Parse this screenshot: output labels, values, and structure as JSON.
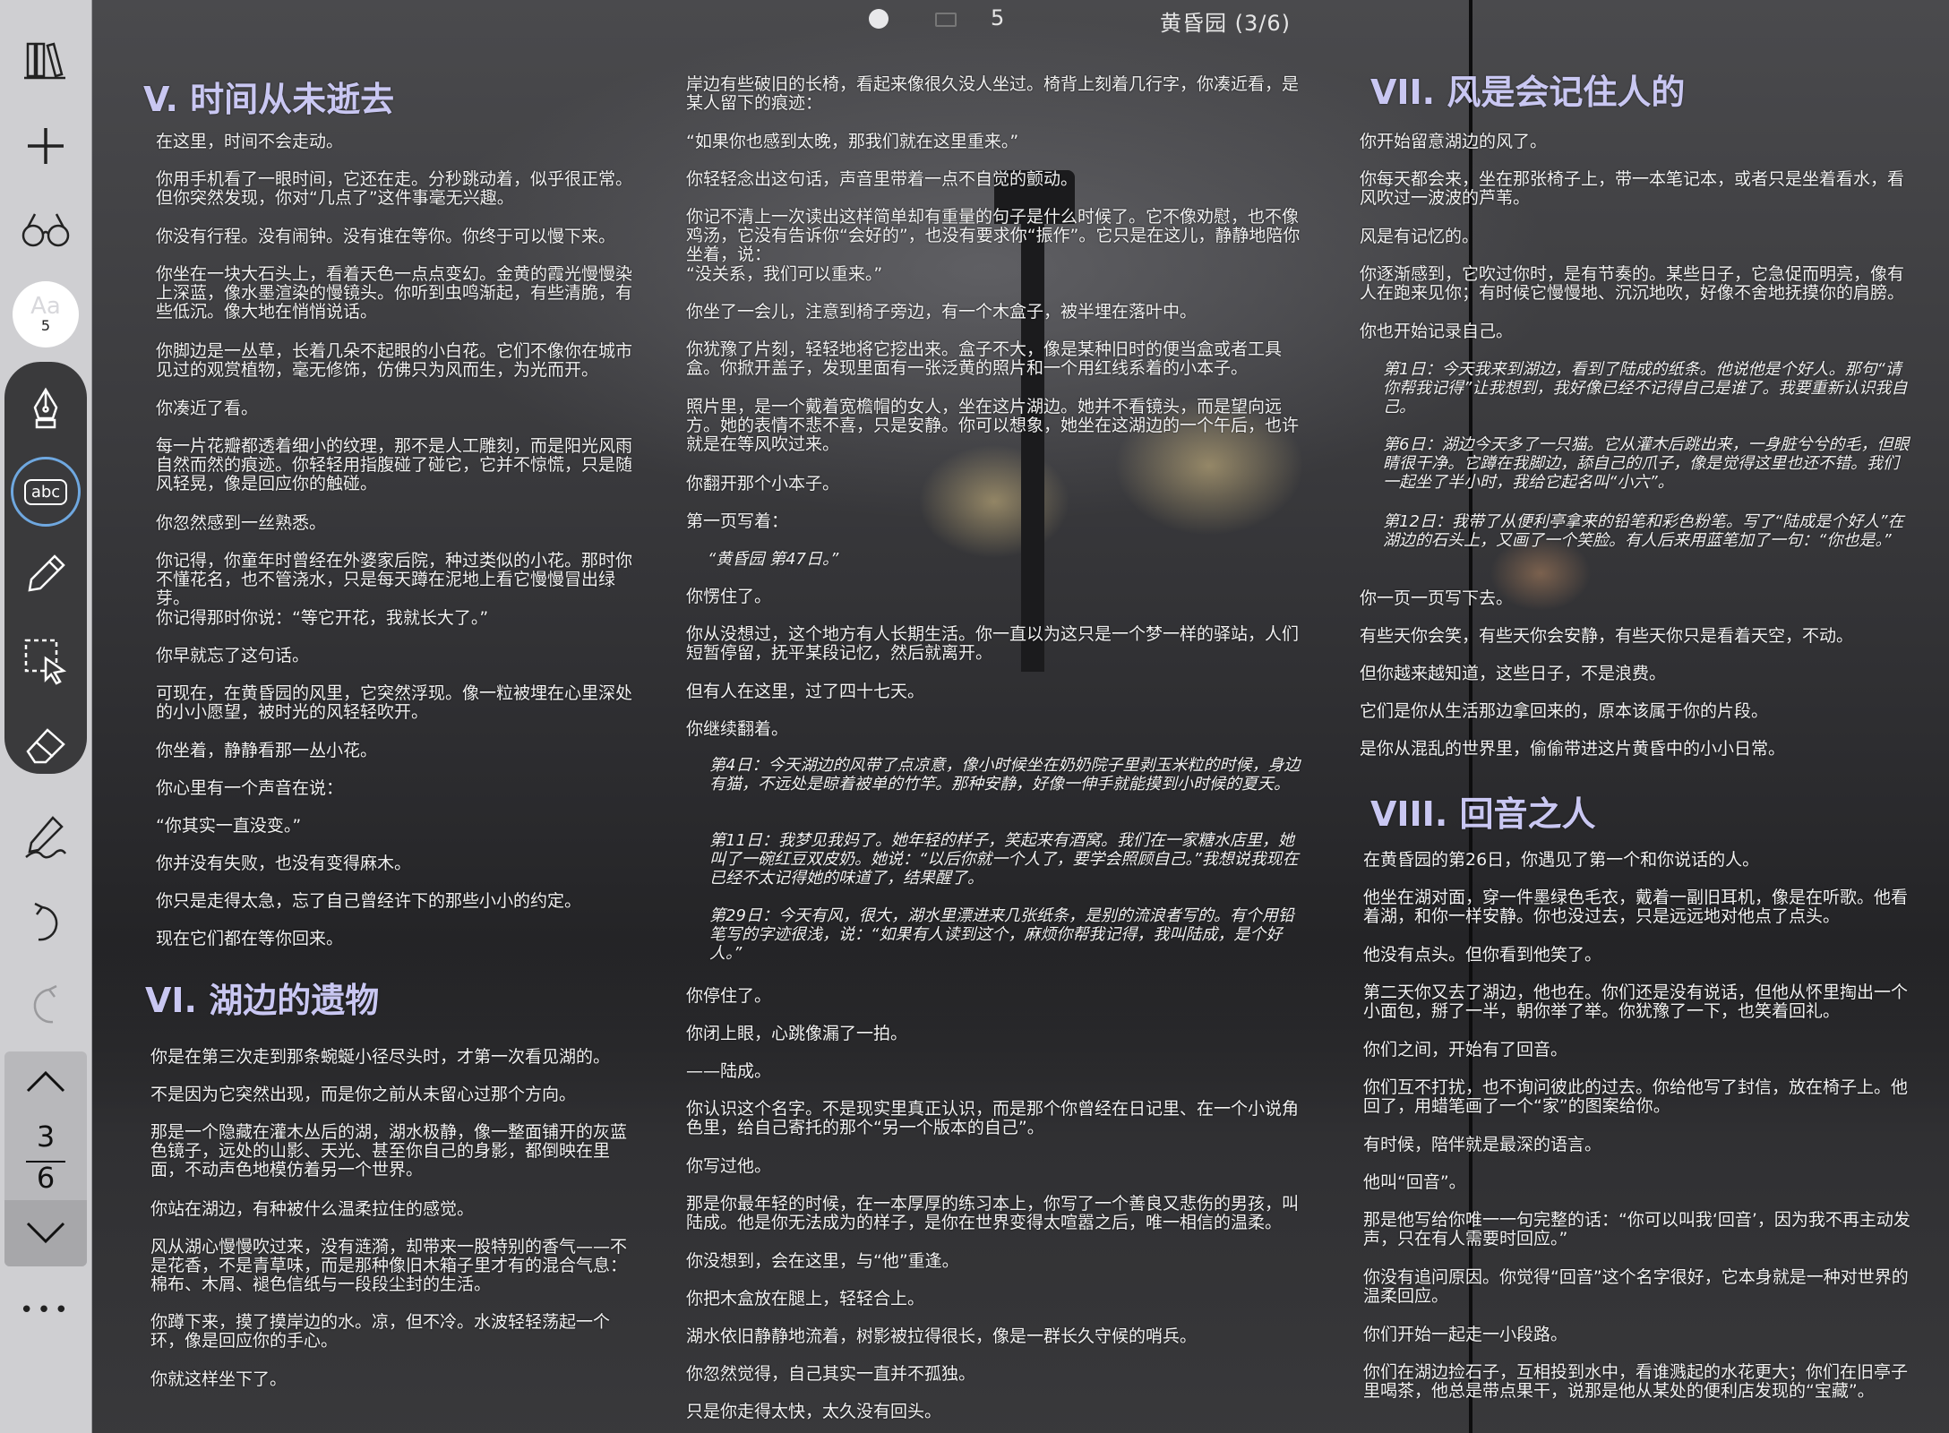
{
  "topbar": {
    "page": "5",
    "title": "黄昏园 (3/6)"
  },
  "sidebar": {
    "font_size": "5",
    "font_label": "Aa",
    "abc_label": "abc",
    "current_page": "3",
    "total_pages": "6",
    "more": "•••"
  },
  "col1": {
    "ch5_title": "V. 时间从未逝去",
    "ch5_paras": [
      "在这里，时间不会走动。",
      "你用手机看了一眼时间，它还在走。分秒跳动着，似乎很正常。但你突然发现，你对“几点了”这件事毫无兴趣。",
      "你没有行程。没有闹钟。没有谁在等你。你终于可以慢下来。",
      "你坐在一块大石头上，看着天色一点点变幻。金黄的霞光慢慢染上深蓝，像水墨渲染的慢镜头。你听到虫鸣渐起，有些清脆，有些低沉。像大地在悄悄说话。",
      "你脚边是一丛草，长着几朵不起眼的小白花。它们不像你在城市见过的观赏植物，毫无修饰，仿佛只为风而生，为光而开。",
      "你凑近了看。",
      "每一片花瓣都透着细小的纹理，那不是人工雕刻，而是阳光风雨自然而然的痕迹。你轻轻用指腹碰了碰它，它并不惊慌，只是随风轻晃，像是回应你的触碰。",
      "你忽然感到一丝熟悉。",
      "你记得，你童年时曾经在外婆家后院，种过类似的小花。那时你不懂花名，也不管浇水，只是每天蹲在泥地上看它慢慢冒出绿芽。",
      "你记得那时你说：“等它开花，我就长大了。”",
      "你早就忘了这句话。",
      "可现在，在黄昏园的风里，它突然浮现。像一粒被埋在心里深处的小小愿望，被时光的风轻轻吹开。",
      "你坐着，静静看那一丛小花。",
      "你心里有一个声音在说：",
      "“你其实一直没变。”",
      "你并没有失败，也没有变得麻木。",
      "你只是走得太急，忘了自己曾经许下的那些小小的约定。",
      "现在它们都在等你回来。"
    ],
    "ch6_title": "VI. 湖边的遗物",
    "ch6_paras": [
      "你是在第三次走到那条蜿蜒小径尽头时，才第一次看见湖的。",
      "不是因为它突然出现，而是你之前从未留心过那个方向。",
      "那是一个隐藏在灌木丛后的湖，湖水极静，像一整面铺开的灰蓝色镜子，远处的山影、天光、甚至你自己的身影，都倒映在里面，不动声色地模仿着另一个世界。",
      "你站在湖边，有种被什么温柔拉住的感觉。",
      "风从湖心慢慢吹过来，没有涟漪，却带来一股特别的香气——不是花香，不是青草味，而是那种像旧木箱子里才有的混合气息：棉布、木屑、褪色信纸与一段段尘封的生活。",
      "你蹲下来，摸了摸岸边的水。凉，但不冷。水波轻轻荡起一个环，像是回应你的手心。",
      "你就这样坐下了。"
    ]
  },
  "col2": {
    "paras_a": [
      "岸边有些破旧的长椅，看起来像很久没人坐过。椅背上刻着几行字，你凑近看，是某人留下的痕迹：",
      "“如果你也感到太晚，那我们就在这里重来。”",
      "你轻轻念出这句话，声音里带着一点不自觉的颤动。",
      "你记不清上一次读出这样简单却有重量的句子是什么时候了。它不像劝慰，也不像鸡汤，它没有告诉你“会好的”，也没有要求你“振作”。它只是在这儿，静静地陪你坐着，说：",
      "“没关系，我们可以重来。”",
      "你坐了一会儿，注意到椅子旁边，有一个木盒子，被半埋在落叶中。",
      "你犹豫了片刻，轻轻地将它挖出来。盒子不大，像是某种旧时的便当盒或者工具盒。你掀开盖子，发现里面有一张泛黄的照片和一个用红线系着的小本子。",
      "照片里，是一个戴着宽檐帽的女人，坐在这片湖边。她并不看镜头，而是望向远方。她的表情不悲不喜，只是安静。你可以想象，她坐在这湖边的一个午后，也许就是在等风吹过来。",
      "你翻开那个小本子。",
      "第一页写着："
    ],
    "quote": "“黄昏园 第47日。”",
    "paras_b": [
      "你愣住了。",
      "你从没想过，这个地方有人长期生活。你一直以为这只是一个梦一样的驿站，人们短暂停留，抚平某段记忆，然后就离开。",
      "但有人在这里，过了四十七天。",
      "你继续翻着。"
    ],
    "journal": [
      "第4日：今天湖边的风带了点凉意，像小时候坐在奶奶院子里剥玉米粒的时候，身边有猫，不远处是晾着被单的竹竿。那种安静，好像一伸手就能摸到小时候的夏天。",
      "第11日：我梦见我妈了。她年轻的样子，笑起来有酒窝。我们在一家糖水店里，她叫了一碗红豆双皮奶。她说：“以后你就一个人了，要学会照顾自己。”我想说我现在已经不太记得她的味道了，结果醒了。",
      "第29日：今天有风，很大，湖水里漂进来几张纸条，是别的流浪者写的。有个用铅笔写的字迹很浅，说：“如果有人读到这个，麻烦你帮我记得，我叫陆成，是个好人。”"
    ],
    "paras_c": [
      "你停住了。",
      "你闭上眼，心跳像漏了一拍。",
      "——陆成。",
      "你认识这个名字。不是现实里真正认识，而是那个你曾经在日记里、在一个小说角色里，给自己寄托的那个“另一个版本的自己”。",
      "你写过他。",
      "那是你最年轻的时候，在一本厚厚的练习本上，你写了一个善良又悲伤的男孩，叫陆成。他是你无法成为的样子，是你在世界变得太喧嚣之后，唯一相信的温柔。",
      "你没想到，会在这里，与“他”重逢。",
      "你把木盒放在腿上，轻轻合上。",
      "湖水依旧静静地流着，树影被拉得很长，像是一群长久守候的哨兵。",
      "你忽然觉得，自己其实一直并不孤独。",
      "只是你走得太快，太久没有回头。"
    ]
  },
  "col3": {
    "ch7_title": "VII. 风是会记住人的",
    "ch7_paras_a": [
      "你开始留意湖边的风了。",
      "你每天都会来，坐在那张椅子上，带一本笔记本，或者只是坐着看水，看风吹过一波波的芦苇。",
      "风是有记忆的。",
      "你逐渐感到，它吹过你时，是有节奏的。某些日子，它急促而明亮，像有人在跑来见你；有时候它慢慢地、沉沉地吹，好像不舍地抚摸你的肩膀。",
      "你也开始记录自己。"
    ],
    "journal": [
      "第1日：今天我来到湖边，看到了陆成的纸条。他说他是个好人。那句“请你帮我记得”让我想到，我好像已经不记得自己是谁了。我要重新认识我自己。",
      "第6日：湖边今天多了一只猫。它从灌木后跳出来，一身脏兮兮的毛，但眼睛很干净。它蹲在我脚边，舔自己的爪子，像是觉得这里也还不错。我们一起坐了半小时，我给它起名叫“小六”。",
      "第12日：我带了从便利亭拿来的铅笔和彩色粉笔。写了“陆成是个好人”在湖边的石头上，又画了一个笑脸。有人后来用蓝笔加了一句：“你也是。”"
    ],
    "ch7_paras_b": [
      "你一页一页写下去。",
      "有些天你会笑，有些天你会安静，有些天你只是看着天空，不动。",
      "但你越来越知道，这些日子，不是浪费。",
      "它们是你从生活那边拿回来的，原本该属于你的片段。",
      "是你从混乱的世界里，偷偷带进这片黄昏中的小小日常。"
    ],
    "ch8_title": "VIII. 回音之人",
    "ch8_paras": [
      "在黄昏园的第26日，你遇见了第一个和你说话的人。",
      "他坐在湖对面，穿一件墨绿色毛衣，戴着一副旧耳机，像是在听歌。他看着湖，和你一样安静。你也没过去，只是远远地对他点了点头。",
      "他没有点头。但你看到他笑了。",
      "第二天你又去了湖边，他也在。你们还是没有说话，但他从怀里掏出一个小面包，掰了一半，朝你举了举。你犹豫了一下，也笑着回礼。",
      "你们之间，开始有了回音。",
      "你们互不打扰，也不询问彼此的过去。你给他写了封信，放在椅子上。他回了，用蜡笔画了一个“家”的图案给你。",
      "有时候，陪伴就是最深的语言。",
      "他叫“回音”。",
      "那是他写给你唯一一句完整的话：“你可以叫我‘回音’，因为我不再主动发声，只在有人需要时回应。”",
      "你没有追问原因。你觉得“回音”这个名字很好，它本身就是一种对世界的温柔回应。",
      "你们开始一起走一小段路。",
      "你们在湖边捡石子，互相投到水中，看谁溅起的水花更大；你们在旧亭子里喝茶，他总是带点果干，说那是他从某处的便利店发现的“宝藏”。"
    ]
  }
}
